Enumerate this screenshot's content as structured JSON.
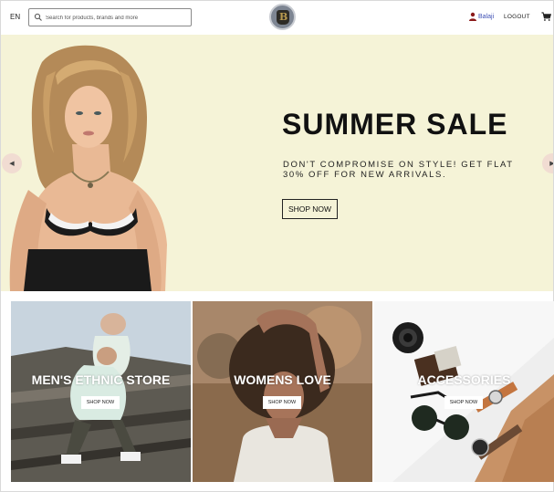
{
  "navbar": {
    "language": "EN",
    "search_placeholder": "Search for products, brands and more",
    "user_name": "Balaji",
    "logout_label": "LOGOUT"
  },
  "hero": {
    "title": "SUMMER SALE",
    "description": "DON'T COMPROMISE ON STYLE! GET FLAT 30% OFF FOR NEW ARRIVALS.",
    "button_label": "SHOP NOW",
    "background_color": "#f5f3d7"
  },
  "categories": [
    {
      "title": "MEN'S ETHNIC STORE",
      "button_label": "SHOP NOW"
    },
    {
      "title": "WOMENS LOVE",
      "button_label": "SHOP NOW"
    },
    {
      "title": "ACCESSORIES",
      "button_label": "SHOP NOW"
    }
  ],
  "icons": {
    "search": "search-icon",
    "user": "person-icon",
    "cart": "shopping-cart-icon",
    "slider_prev": "chevron-left-icon",
    "slider_next": "chevron-right-icon"
  },
  "colors": {
    "username": "#3f51b5",
    "user_icon": "#8b1a1a",
    "arrow_bg": "#f1dcd2"
  }
}
